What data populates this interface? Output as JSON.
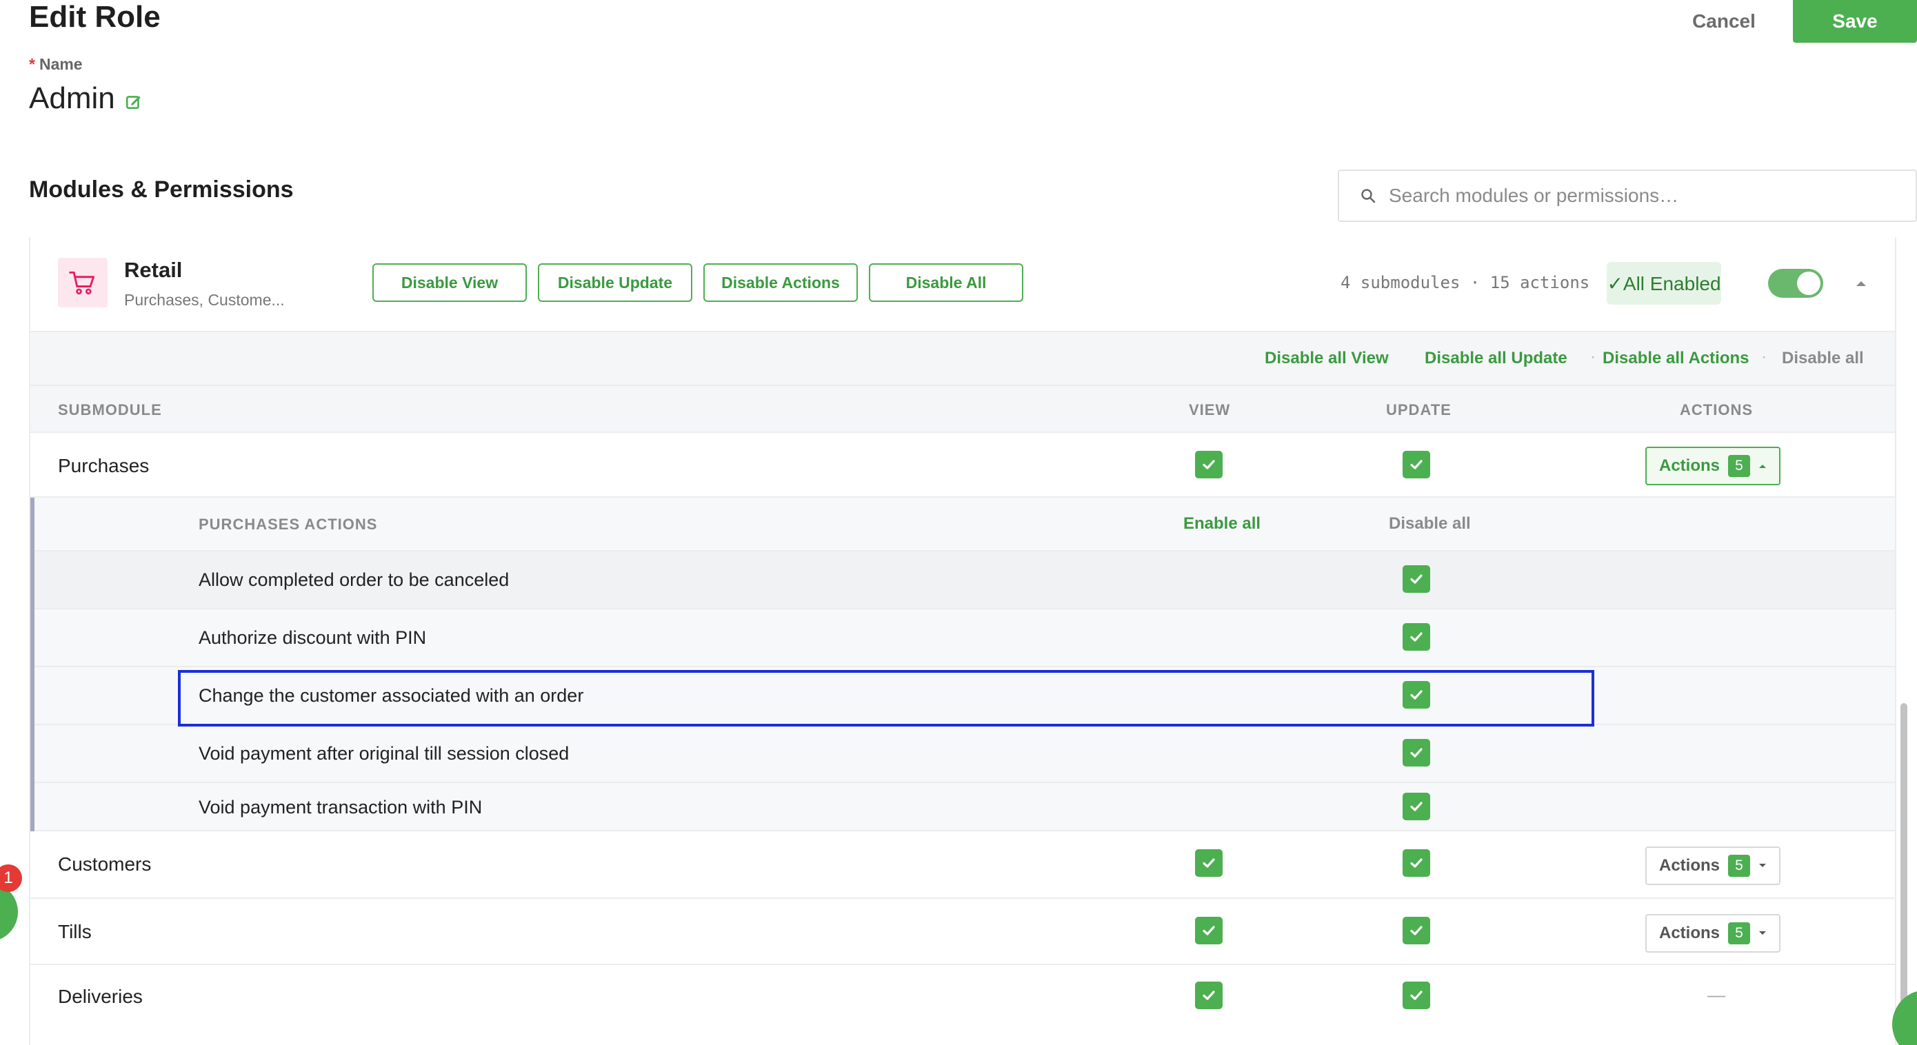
{
  "header": {
    "title": "Edit Role",
    "cancel_label": "Cancel",
    "save_label": "Save"
  },
  "name_field": {
    "required_mark": "*",
    "label": "Name",
    "value": "Admin"
  },
  "section": {
    "title": "Modules & Permissions",
    "search_placeholder": "Search modules or permissions…"
  },
  "module": {
    "name": "Retail",
    "subtitle": "Purchases, Custome...",
    "buttons": [
      "Disable View",
      "Disable Update",
      "Disable Actions",
      "Disable All"
    ],
    "summary": "4 submodules · 15 actions",
    "status": "✓All Enabled",
    "enabled": true
  },
  "bulk_links": [
    "Disable all View",
    "Disable all Update",
    "Disable all Actions",
    "Disable all"
  ],
  "bulk_separator": "·",
  "table": {
    "columns": [
      "SUBMODULE",
      "VIEW",
      "UPDATE",
      "ACTIONS"
    ],
    "rows": [
      {
        "name": "Purchases",
        "view": true,
        "update": true,
        "actions_label": "Actions",
        "actions_count": "5",
        "expanded": true
      },
      {
        "name": "Customers",
        "view": true,
        "update": true,
        "actions_label": "Actions",
        "actions_count": "5",
        "expanded": false
      },
      {
        "name": "Tills",
        "view": true,
        "update": true,
        "actions_label": "Actions",
        "actions_count": "5",
        "expanded": false
      },
      {
        "name": "Deliveries",
        "view": true,
        "update": true,
        "actions_label": "",
        "actions_count": "",
        "empty_actions": "—"
      }
    ]
  },
  "purchases_actions": {
    "header": "PURCHASES ACTIONS",
    "enable_all": "Enable all",
    "disable_all": "Disable all",
    "items": [
      {
        "label": "Allow completed order to be canceled",
        "enabled": true
      },
      {
        "label": "Authorize discount with PIN",
        "enabled": true
      },
      {
        "label": "Change the customer associated with an order",
        "enabled": true
      },
      {
        "label": "Void payment after original till session closed",
        "enabled": true
      },
      {
        "label": "Void payment transaction with PIN",
        "enabled": true
      }
    ]
  },
  "notification_count": "1",
  "colors": {
    "accent": "#4caf50",
    "highlight": "#1a2fd8",
    "badge": "#e53935"
  }
}
